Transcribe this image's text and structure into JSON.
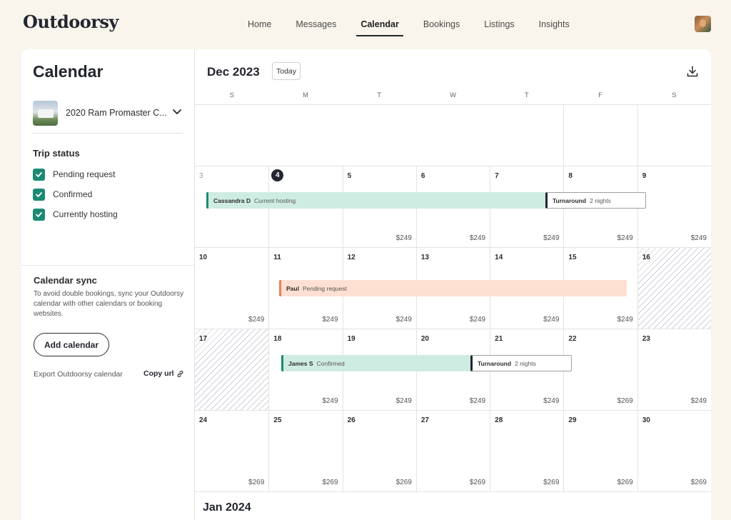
{
  "app": {
    "logo": "Outdoorsy"
  },
  "nav": [
    {
      "label": "Home",
      "active": false
    },
    {
      "label": "Messages",
      "active": false
    },
    {
      "label": "Calendar",
      "active": true
    },
    {
      "label": "Bookings",
      "active": false
    },
    {
      "label": "Listings",
      "active": false
    },
    {
      "label": "Insights",
      "active": false
    }
  ],
  "sidebar": {
    "title": "Calendar",
    "vehicle_name": "2020 Ram Promaster C...",
    "trip_status_title": "Trip status",
    "statuses": [
      {
        "label": "Pending request",
        "checked": true
      },
      {
        "label": "Confirmed",
        "checked": true
      },
      {
        "label": "Currently hosting",
        "checked": true
      }
    ],
    "sync_title": "Calendar sync",
    "sync_desc": "To avoid double bookings, sync your Outdoorsy calendar with other calendars or booking websites.",
    "add_calendar": "Add calendar",
    "export_label": "Export Outdoorsy calendar",
    "copy_url": "Copy url"
  },
  "calendar": {
    "month": "Dec 2023",
    "today_label": "Today",
    "next_month": "Jan 2024",
    "weekdays": [
      "S",
      "M",
      "T",
      "W",
      "T",
      "F",
      "S"
    ],
    "weeks": [
      [
        null,
        null,
        null,
        null,
        null,
        null,
        null
      ],
      [
        {
          "day": "3",
          "price": "",
          "muted": true
        },
        {
          "day": "4",
          "price": "",
          "today": true
        },
        {
          "day": "5",
          "price": "$249"
        },
        {
          "day": "6",
          "price": "$249"
        },
        {
          "day": "7",
          "price": "$249"
        },
        {
          "day": "8",
          "price": "$249"
        },
        {
          "day": "9",
          "price": "$249"
        }
      ],
      [
        {
          "day": "10",
          "price": "$249"
        },
        {
          "day": "11",
          "price": "$249"
        },
        {
          "day": "12",
          "price": "$249"
        },
        {
          "day": "13",
          "price": "$249"
        },
        {
          "day": "14",
          "price": "$249"
        },
        {
          "day": "15",
          "price": "$249"
        },
        {
          "day": "16",
          "price": "",
          "blocked": true
        }
      ],
      [
        {
          "day": "17",
          "price": "",
          "blocked": true
        },
        {
          "day": "18",
          "price": "$249"
        },
        {
          "day": "19",
          "price": "$249"
        },
        {
          "day": "20",
          "price": "$249"
        },
        {
          "day": "21",
          "price": "$249"
        },
        {
          "day": "22",
          "price": "$269"
        },
        {
          "day": "23",
          "price": "$249"
        }
      ],
      [
        {
          "day": "24",
          "price": "$269"
        },
        {
          "day": "25",
          "price": "$269"
        },
        {
          "day": "26",
          "price": "$269"
        },
        {
          "day": "27",
          "price": "$269"
        },
        {
          "day": "28",
          "price": "$269"
        },
        {
          "day": "29",
          "price": "$269"
        },
        {
          "day": "30",
          "price": "$269"
        }
      ]
    ],
    "events": [
      {
        "who": "Cassandra D",
        "what": "Current hosting",
        "kind": "hosting"
      },
      {
        "who": "Turnaround",
        "what": "2 nights",
        "kind": "turnaround"
      },
      {
        "who": "Paul",
        "what": "Pending request",
        "kind": "pending"
      },
      {
        "who": "James S",
        "what": "Confirmed",
        "kind": "confirmed"
      },
      {
        "who": "Turnaround",
        "what": "2 nights",
        "kind": "turnaround"
      }
    ]
  },
  "colors": {
    "accent_green": "#1c8a72",
    "pending_orange": "#e9805a",
    "background": "#f9f5ec"
  }
}
